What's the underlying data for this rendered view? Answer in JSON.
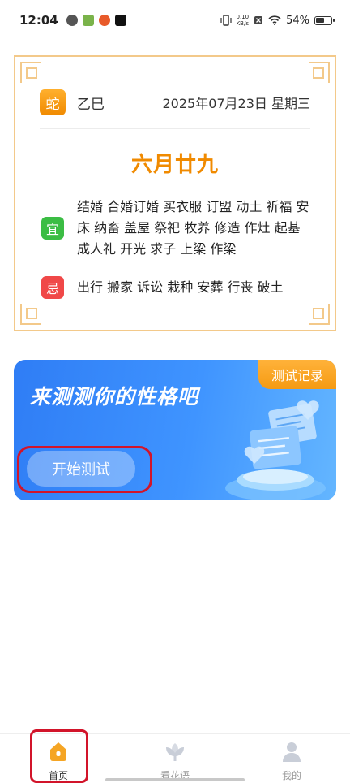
{
  "status_bar": {
    "time": "12:04",
    "net_speed_value": "0.10",
    "net_speed_unit": "KB/s",
    "battery": "54%"
  },
  "almanac": {
    "zodiac": "蛇",
    "ganzhi": "乙巳",
    "date": "2025年07月23日 星期三",
    "lunar_date": "六月廿九",
    "good_tag": "宜",
    "good_items": "结婚 合婚订婚 买衣服 订盟 动土 祈福 安床 纳畜 盖屋 祭祀 牧养 修造 作灶 起基 成人礼 开光 求子 上梁 作梁",
    "bad_tag": "忌",
    "bad_items": "出行 搬家 诉讼 栽种 安葬 行丧 破土",
    "colors": {
      "accent": "#f08a00",
      "border": "#f3c98a",
      "good": "#3bbd44",
      "bad": "#f04848"
    }
  },
  "banner": {
    "title": "来测测你的性格吧",
    "record_button": "测试记录",
    "start_button": "开始测试",
    "colors": {
      "background": "#2f7df5",
      "record": "#f59a12"
    }
  },
  "bottom_nav": {
    "items": [
      {
        "label": "首页",
        "icon": "home-icon",
        "active": true
      },
      {
        "label": "看花语",
        "icon": "flower-icon",
        "active": false
      },
      {
        "label": "我的",
        "icon": "user-icon",
        "active": false
      }
    ]
  }
}
